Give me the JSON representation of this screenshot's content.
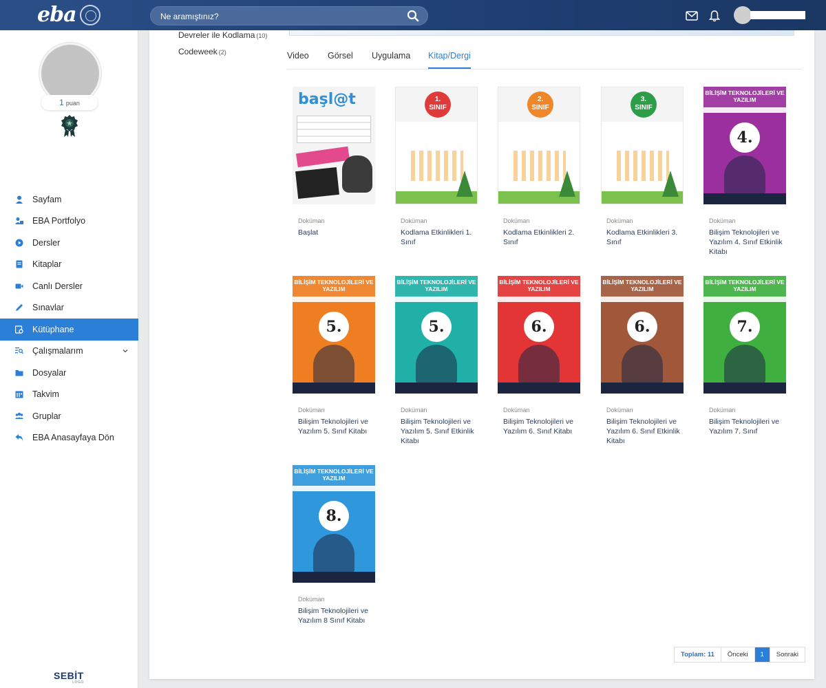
{
  "header": {
    "logo": "eba",
    "search_placeholder": "Ne aramıştınız?"
  },
  "profile": {
    "points_value": "1",
    "points_label": "puan"
  },
  "sidebar": {
    "items": [
      {
        "label": "Sayfam",
        "icon": "user-icon"
      },
      {
        "label": "EBA Portfolyo",
        "icon": "portfolio-icon"
      },
      {
        "label": "Dersler",
        "icon": "play-circle-icon"
      },
      {
        "label": "Kitaplar",
        "icon": "book-icon"
      },
      {
        "label": "Canlı Dersler",
        "icon": "video-camera-icon"
      },
      {
        "label": "Sınavlar",
        "icon": "pencil-icon"
      },
      {
        "label": "Kütüphane",
        "icon": "library-icon",
        "active": true
      },
      {
        "label": "Çalışmalarım",
        "icon": "list-search-icon",
        "expandable": true
      },
      {
        "label": "Dosyalar",
        "icon": "folder-icon"
      },
      {
        "label": "Takvim",
        "icon": "calendar-icon"
      },
      {
        "label": "Gruplar",
        "icon": "group-icon"
      },
      {
        "label": "EBA Anasayfaya Dön",
        "icon": "back-arrow-icon"
      }
    ],
    "footer_brand": "SEBİT",
    "footer_sub": "LOGO"
  },
  "categories": [
    {
      "label": "Devreler ile Kodlama",
      "count": "(10)"
    },
    {
      "label": "Codeweek",
      "count": "(2)"
    }
  ],
  "tabs": [
    {
      "label": "Video"
    },
    {
      "label": "Görsel"
    },
    {
      "label": "Uygulama"
    },
    {
      "label": "Kitap/Dergi",
      "active": true
    }
  ],
  "cards": [
    {
      "type": "Doküman",
      "title": "Başlat",
      "cover": "baslat",
      "color": "#f2f2f2"
    },
    {
      "type": "Doküman",
      "title": "Kodlama Etkinlikleri 1. Sınıf",
      "cover": "kodlama",
      "num": "1.\nSINIF",
      "color": "#e03a3a"
    },
    {
      "type": "Doküman",
      "title": "Kodlama Etkinlikleri 2. Sınıf",
      "cover": "kodlama",
      "num": "2.\nSINIF",
      "color": "#f0862a"
    },
    {
      "type": "Doküman",
      "title": "Kodlama Etkinlikleri 3. Sınıf",
      "cover": "kodlama",
      "num": "3.\nSINIF",
      "color": "#2e9d4a"
    },
    {
      "type": "Doküman",
      "title": "Bilişim Teknolojileri ve Yazılım 4. Sınıf Etkinlik Kitabı",
      "cover": "bty",
      "num": "4.",
      "color": "#9b2f9e",
      "cover_title": "BİLİŞİM TEKNOLOJİLERİ VE YAZILIM"
    },
    {
      "type": "Doküman",
      "title": "Bilişim Teknolojileri ve Yazılım 5. Sınıf Kitabı",
      "cover": "bty",
      "num": "5.",
      "color": "#ef7e22",
      "cover_title": "BİLİŞİM TEKNOLOJİLERİ VE YAZILIM"
    },
    {
      "type": "Doküman",
      "title": "Bilişim Teknolojileri ve Yazılım 5. Sınıf Etkinlik Kitabı",
      "cover": "bty",
      "num": "5.",
      "color": "#20b0a8",
      "cover_title": "BİLİŞİM TEKNOLOJİLERİ VE YAZILIM"
    },
    {
      "type": "Doküman",
      "title": "Bilişim Teknolojileri ve Yazılım 6. Sınıf Kitabı",
      "cover": "bty",
      "num": "6.",
      "color": "#e33535",
      "cover_title": "BİLİŞİM TEKNOLOJİLERİ VE YAZILIM"
    },
    {
      "type": "Doküman",
      "title": "Bilişim Teknolojileri ve Yazılım 6. Sınıf Etkinlik Kitabı",
      "cover": "bty",
      "num": "6.",
      "color": "#a0573a",
      "cover_title": "BİLİŞİM TEKNOLOJİLERİ VE YAZILIM"
    },
    {
      "type": "Doküman",
      "title": "Bilişim Teknolojileri ve Yazılım 7. Sınıf",
      "cover": "bty",
      "num": "7.",
      "color": "#3fb03f",
      "cover_title": "BİLİŞİM TEKNOLOJİLERİ VE YAZILIM"
    },
    {
      "type": "Doküman",
      "title": "Bilişim Teknolojileri ve Yazılım 8 Sınıf Kitabı",
      "cover": "bty",
      "num": "8.",
      "color": "#2f97dc",
      "cover_title": "BİLİŞİM TEKNOLOJİLERİ VE YAZILIM"
    }
  ],
  "pagination": {
    "total": "Toplam: 11",
    "prev": "Önceki",
    "current": "1",
    "next": "Sonraki"
  },
  "colors": {
    "header": "#1f3f73",
    "accent": "#2b7fd6"
  }
}
